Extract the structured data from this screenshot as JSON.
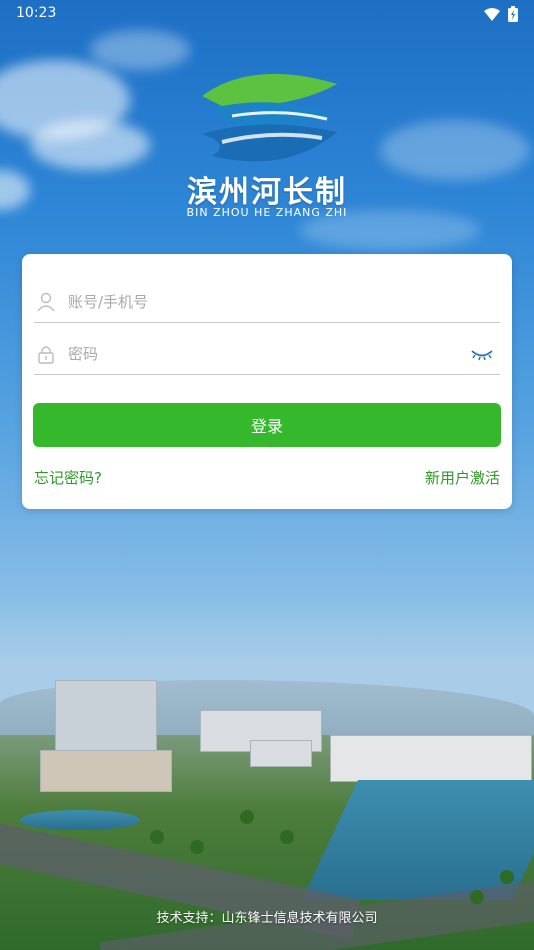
{
  "status_bar": {
    "time": "10:23"
  },
  "brand": {
    "title": "滨州河长制",
    "subtitle": "BIN ZHOU HE ZHANG ZHI"
  },
  "login": {
    "account_placeholder": "账号/手机号",
    "password_placeholder": "密码",
    "submit_label": "登录",
    "forgot_label": "忘记密码?",
    "activate_label": "新用户激活"
  },
  "footer": {
    "support_text": "技术支持：山东锋士信息技术有限公司"
  },
  "colors": {
    "primary_green": "#36b82c",
    "link_green": "#2e9a26",
    "eye_blue": "#2a6fb8"
  }
}
